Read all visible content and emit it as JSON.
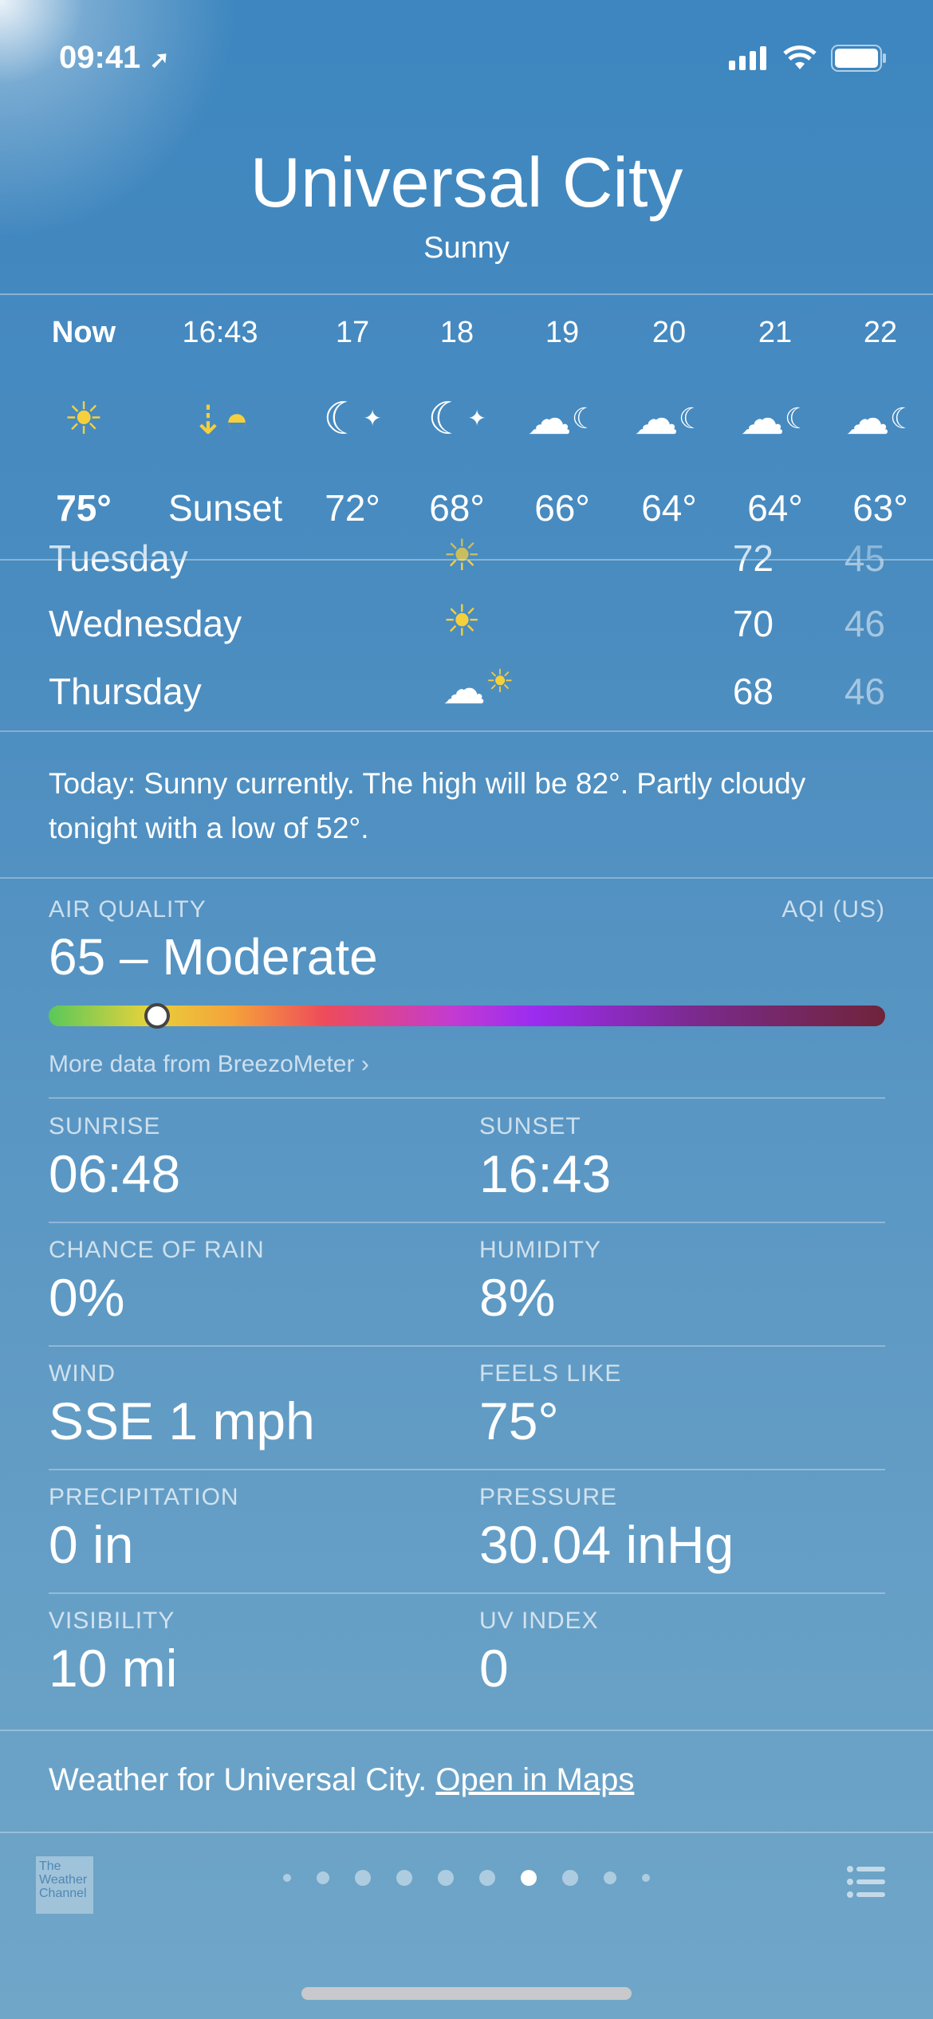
{
  "status": {
    "time": "09:41"
  },
  "header": {
    "city": "Universal City",
    "condition": "Sunny"
  },
  "hourly": [
    {
      "label": "Now",
      "icon": "sun-icon",
      "temp": "75°"
    },
    {
      "label": "16:43",
      "icon": "sunset-icon",
      "temp": "Sunset"
    },
    {
      "label": "17",
      "icon": "moon-stars-icon",
      "temp": "72°"
    },
    {
      "label": "18",
      "icon": "moon-stars-icon",
      "temp": "68°"
    },
    {
      "label": "19",
      "icon": "cloud-moon-icon",
      "temp": "66°"
    },
    {
      "label": "20",
      "icon": "cloud-moon-icon",
      "temp": "64°"
    },
    {
      "label": "21",
      "icon": "cloud-moon-icon",
      "temp": "64°"
    },
    {
      "label": "22",
      "icon": "cloud-moon-icon",
      "temp": "63°"
    }
  ],
  "daily": [
    {
      "day": "Tuesday",
      "icon": "sun-icon",
      "high": "72",
      "low": "45"
    },
    {
      "day": "Wednesday",
      "icon": "sun-icon",
      "high": "70",
      "low": "46"
    },
    {
      "day": "Thursday",
      "icon": "cloud-sun-icon",
      "high": "68",
      "low": "46"
    }
  ],
  "summary": "Today: Sunny currently. The high will be 82°. Partly cloudy tonight with a low of 52°.",
  "air_quality": {
    "label": "AIR QUALITY",
    "unit": "AQI (US)",
    "value": "65 – Moderate",
    "index": 65,
    "more": "More data from BreezoMeter ›"
  },
  "details": [
    {
      "label": "SUNRISE",
      "value": "06:48"
    },
    {
      "label": "SUNSET",
      "value": "16:43"
    },
    {
      "label": "CHANCE OF RAIN",
      "value": "0%"
    },
    {
      "label": "HUMIDITY",
      "value": "8%"
    },
    {
      "label": "WIND",
      "value": "SSE 1 mph"
    },
    {
      "label": "FEELS LIKE",
      "value": "75°"
    },
    {
      "label": "PRECIPITATION",
      "value": "0 in"
    },
    {
      "label": "PRESSURE",
      "value": "30.04 inHg"
    },
    {
      "label": "VISIBILITY",
      "value": "10 mi"
    },
    {
      "label": "UV INDEX",
      "value": "0"
    }
  ],
  "footer": {
    "text": "Weather for Universal City.",
    "link": "Open in Maps"
  },
  "bottom": {
    "logo": "The Weather Channel",
    "page_count": 10,
    "current_page": 7
  }
}
